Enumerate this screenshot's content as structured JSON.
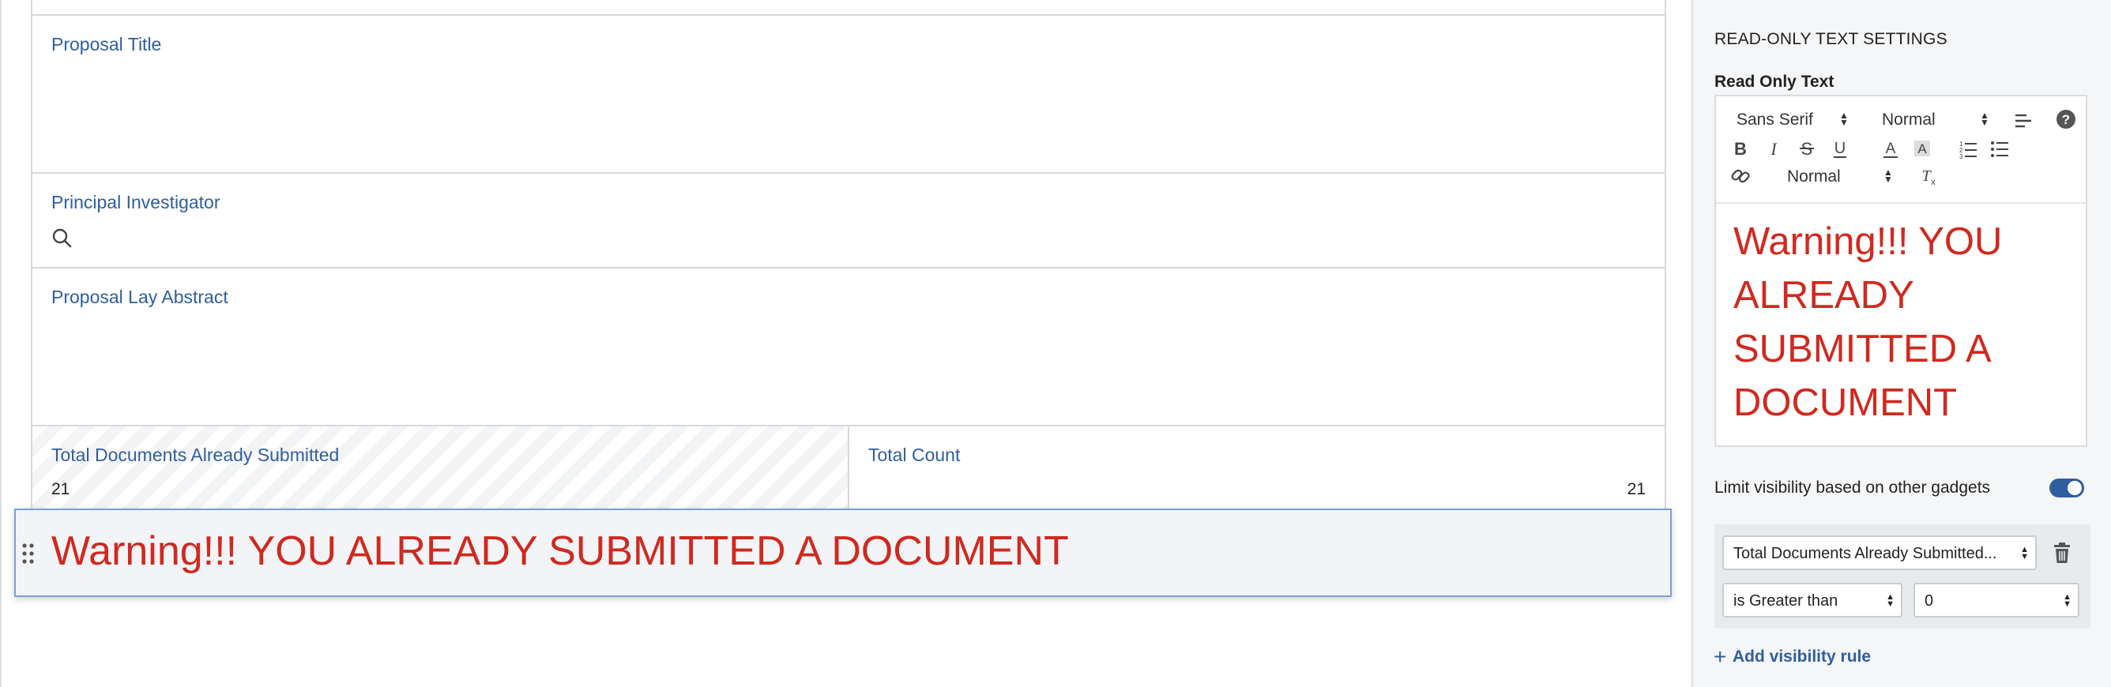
{
  "form": {
    "fields": {
      "proposal_title": "Proposal Title",
      "principal_investigator": "Principal Investigator",
      "proposal_lay_abstract": "Proposal Lay Abstract",
      "total_documents": "Total Documents Already Submitted",
      "total_documents_value": "21",
      "total_count": "Total Count",
      "total_count_value": "21"
    },
    "warning_text": "Warning!!! YOU ALREADY SUBMITTED A DOCUMENT"
  },
  "panel": {
    "heading": "READ-ONLY TEXT SETTINGS",
    "editor_label": "Read Only Text",
    "toolbar": {
      "font": "Sans Serif",
      "size": "Normal",
      "heading": "Normal"
    },
    "editor_lines": [
      "Warning!!! YOU",
      "ALREADY",
      "SUBMITTED A",
      "DOCUMENT"
    ],
    "visibility_label": "Limit visibility based on other gadgets",
    "visibility_enabled": true,
    "rule": {
      "field": "Total Documents Already Submitted...",
      "operator": "is Greater than",
      "value": "0"
    },
    "add_rule_label": "Add visibility rule"
  },
  "colors": {
    "accent": "#2f5e9e",
    "warning": "#d0291f",
    "selection_border": "#7d9fd6"
  }
}
